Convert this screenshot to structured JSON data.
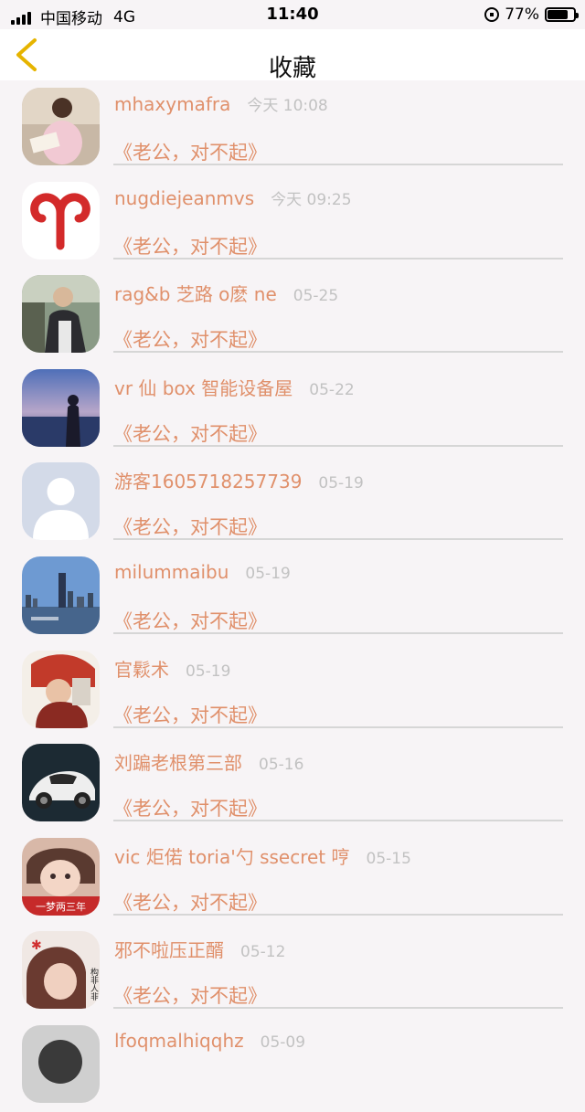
{
  "status_bar": {
    "carrier": "中国移动",
    "network": "4G",
    "time": "11:40",
    "battery": "77%",
    "battery_level": 0.77
  },
  "nav": {
    "back_icon": "chevron-left-icon",
    "title": "收藏",
    "accent_color": "#e6b400"
  },
  "items": [
    {
      "name": "mhaxymafra",
      "time": "今天 10:08",
      "message": "《老公，对不起》"
    },
    {
      "name": "nugdiejeanmvs",
      "time": "今天 09:25",
      "message": "《老公，对不起》"
    },
    {
      "name": "rag&b 芝路 o麽 ne",
      "time": "05-25",
      "message": "《老公，对不起》"
    },
    {
      "name": "vr 仙 box 智能设备屋",
      "time": "05-22",
      "message": "《老公，对不起》"
    },
    {
      "name": "游客1605718257739",
      "time": "05-19",
      "message": "《老公，对不起》"
    },
    {
      "name": "milummaibu",
      "time": "05-19",
      "message": "《老公，对不起》"
    },
    {
      "name": "官鬏术",
      "time": "05-19",
      "message": "《老公，对不起》"
    },
    {
      "name": "刘蹁老根第三部",
      "time": "05-16",
      "message": "《老公，对不起》"
    },
    {
      "name": "vic 炬偌 toria'勺 ssecret 哼",
      "time": "05-15",
      "message": "《老公，对不起》"
    },
    {
      "name": "邪不啦压正醑",
      "time": "05-12",
      "message": "《老公，对不起》"
    },
    {
      "name": "lfoqmalhiqqhz",
      "time": "05-09",
      "message": ""
    }
  ],
  "avatar_texts": {
    "item8": "一梦两三年",
    "item9": "构非人非"
  }
}
